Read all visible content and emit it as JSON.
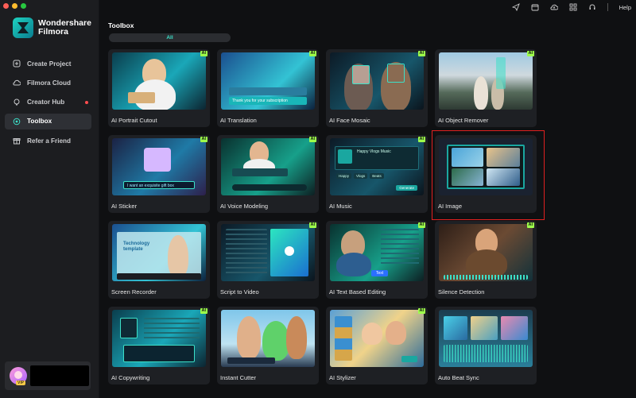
{
  "window": {
    "help_label": "Help"
  },
  "brand": {
    "line1": "Wondershare",
    "line2": "Filmora"
  },
  "sidebar": {
    "items": [
      {
        "label": "Create Project",
        "icon": "plus-circle-icon"
      },
      {
        "label": "Filmora Cloud",
        "icon": "cloud-icon"
      },
      {
        "label": "Creator Hub",
        "icon": "bulb-icon",
        "notification": true
      },
      {
        "label": "Toolbox",
        "icon": "toolbox-icon",
        "active": true
      },
      {
        "label": "Refer a Friend",
        "icon": "gift-icon"
      }
    ],
    "profile": {
      "badge": "VIP"
    }
  },
  "main": {
    "title": "Toolbox",
    "filter_all": "All",
    "tools": [
      {
        "label": "AI Portrait Cutout",
        "ai": true
      },
      {
        "label": "AI Translation",
        "ai": true,
        "thumb_text": "Thank you for your subscription"
      },
      {
        "label": "AI Face Mosaic",
        "ai": true
      },
      {
        "label": "AI Object Remover",
        "ai": true
      },
      {
        "label": "AI Sticker",
        "ai": true,
        "thumb_text": "I want an exquisite gift box"
      },
      {
        "label": "AI Voice Modeling",
        "ai": true
      },
      {
        "label": "AI Music",
        "ai": true,
        "thumb_text": "Happy Vlogs Music",
        "thumb_tags": [
          "Happy",
          "Vlogs",
          "Beats"
        ],
        "thumb_button": "Generate"
      },
      {
        "label": "AI Image",
        "ai": false,
        "selected": true
      },
      {
        "label": "Screen Recorder",
        "ai": false,
        "thumb_text": "Technology template"
      },
      {
        "label": "Script to Video",
        "ai": true
      },
      {
        "label": "AI Text Based Editing",
        "ai": true,
        "thumb_button": "Text"
      },
      {
        "label": "Silence Detection",
        "ai": true
      },
      {
        "label": "AI Copywriting",
        "ai": true
      },
      {
        "label": "Instant Cutter",
        "ai": false
      },
      {
        "label": "AI Stylizer",
        "ai": true
      },
      {
        "label": "Auto Beat Sync",
        "ai": false
      }
    ]
  },
  "colors": {
    "accent": "#3ce0c8",
    "ai_badge": "#9dff4b",
    "selection": "#e02020"
  }
}
